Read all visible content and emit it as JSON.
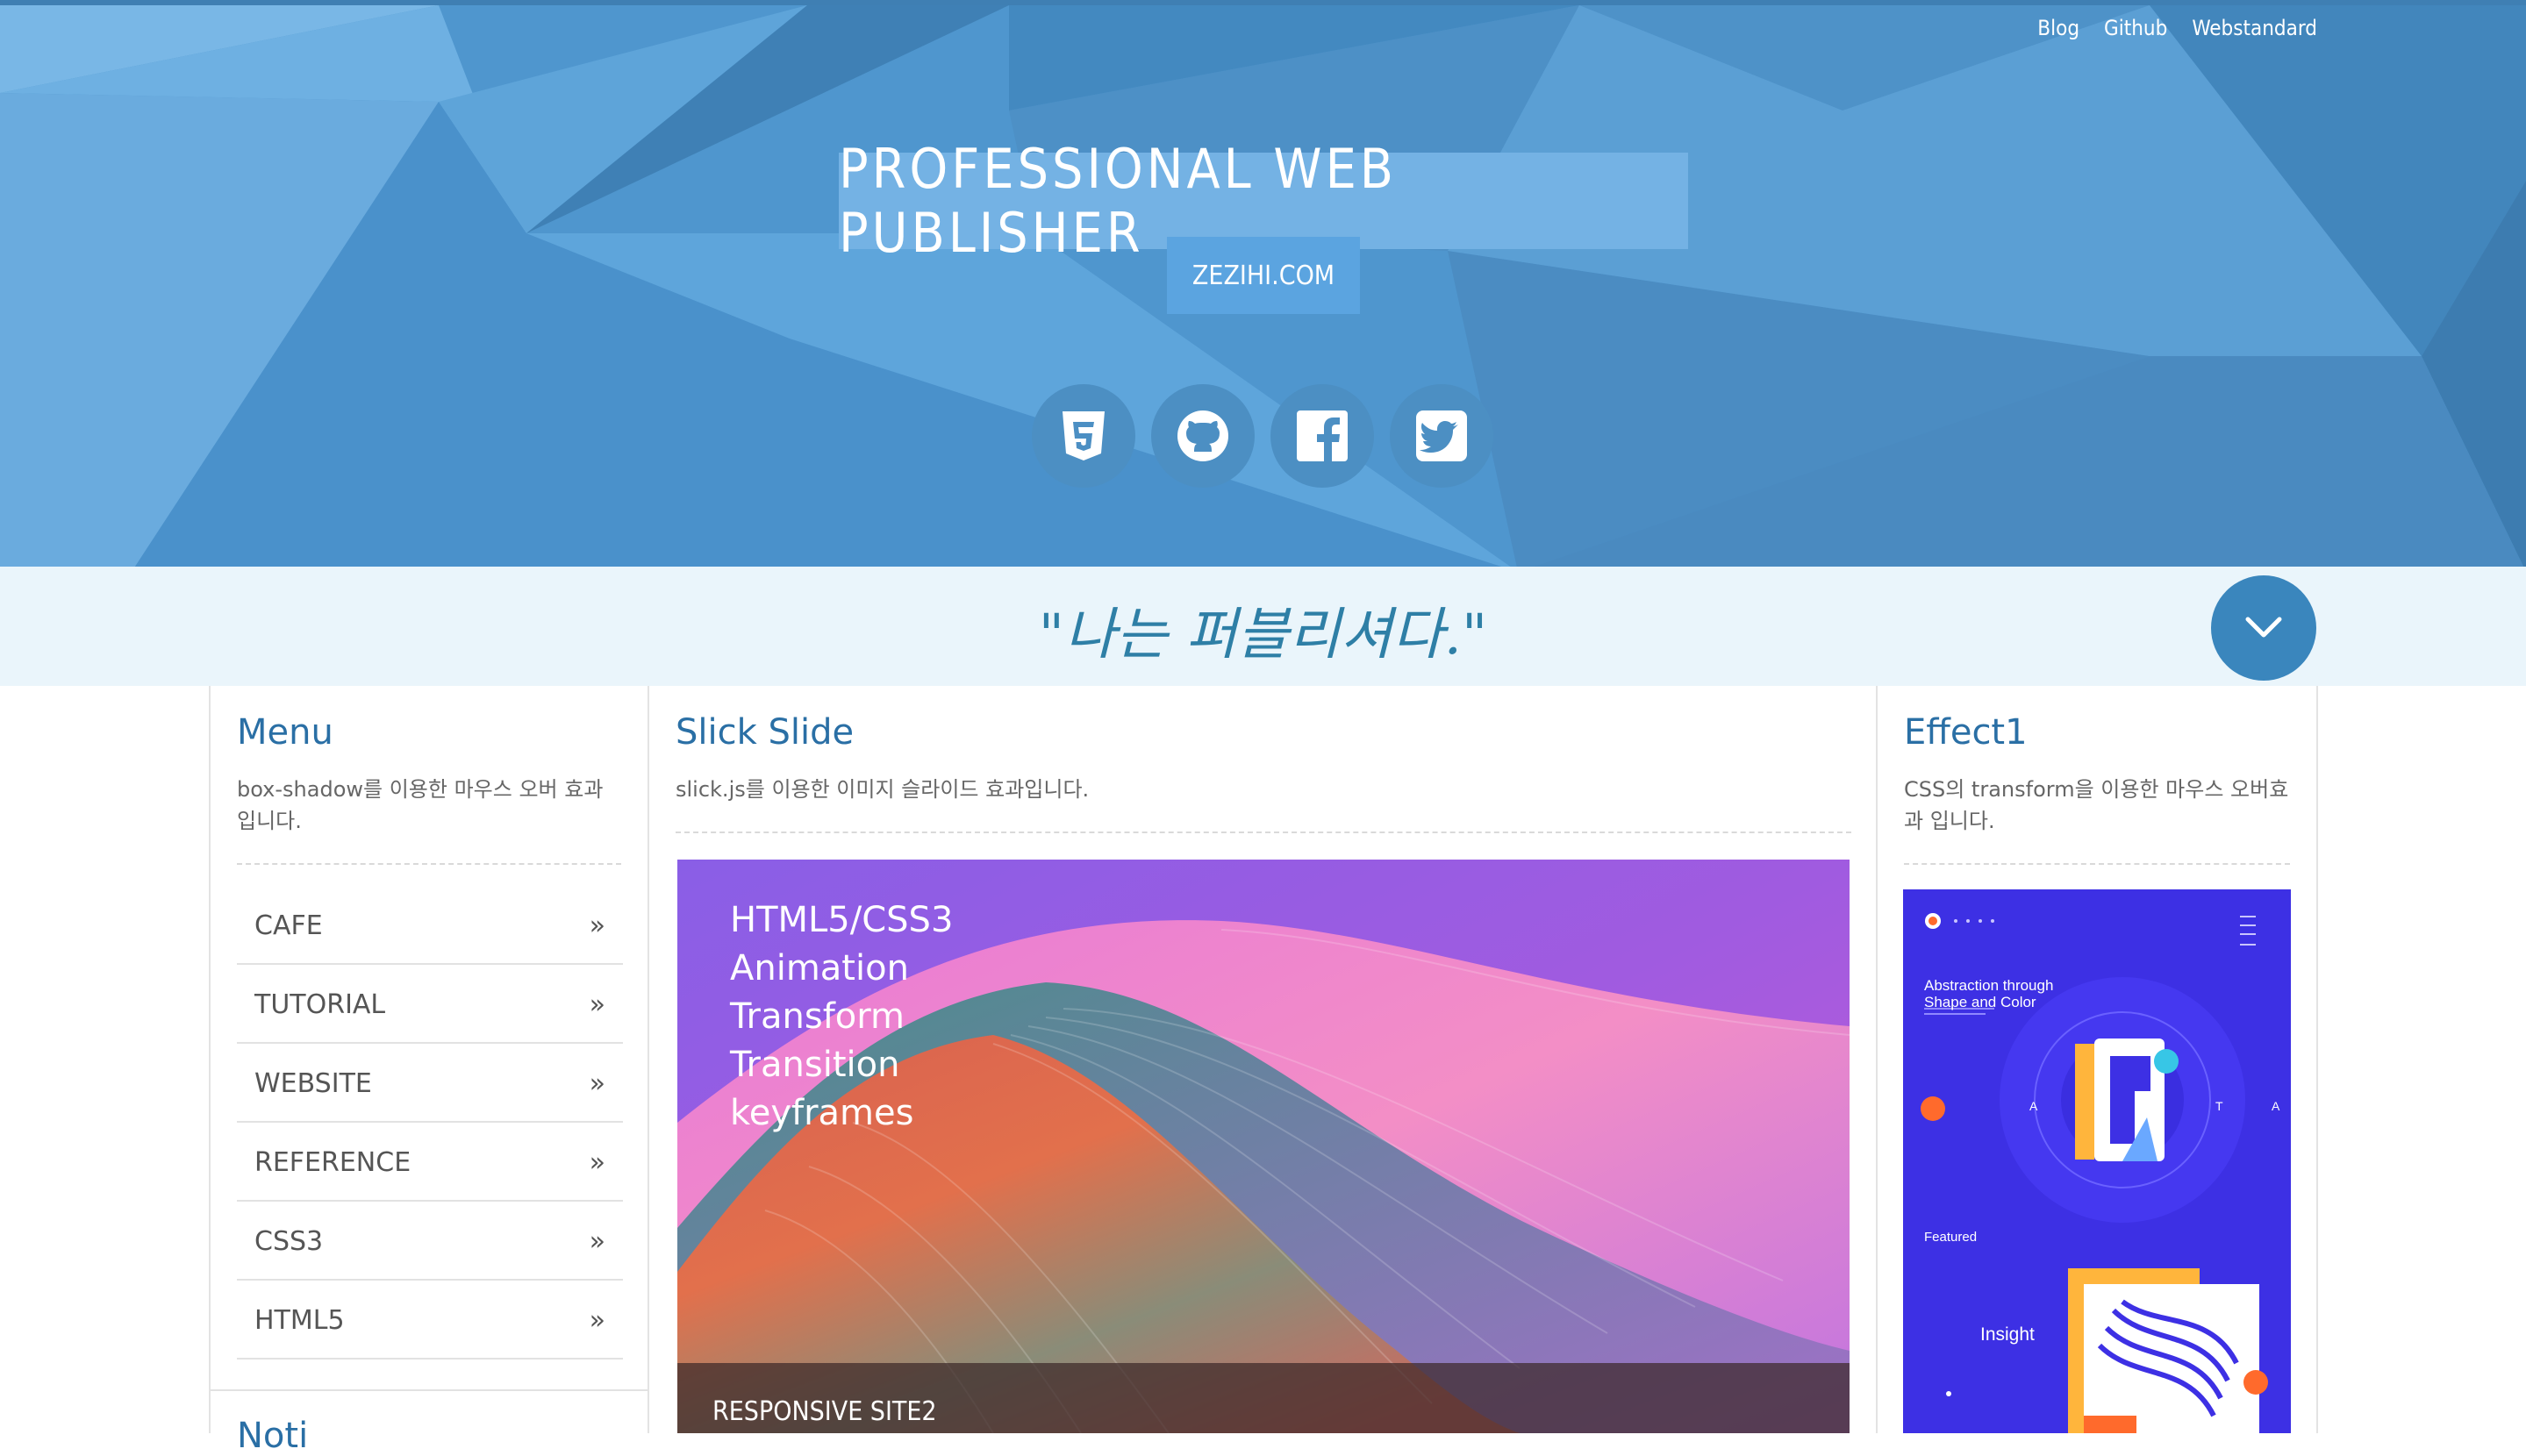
{
  "top_nav": [
    "Blog",
    "Github",
    "Webstandard"
  ],
  "header": {
    "title": "PROFESSIONAL WEB PUBLISHER",
    "domain": "ZEZIHI.COM"
  },
  "social_icons": [
    "html5-icon",
    "github-icon",
    "facebook-icon",
    "twitter-icon"
  ],
  "quote": "\"나는 퍼블리셔다.\"",
  "menu": {
    "title": "Menu",
    "desc": "box-shadow를 이용한 마우스 오버 효과입니다.",
    "items": [
      "CAFE",
      "TUTORIAL",
      "WEBSITE",
      "REFERENCE",
      "CSS3",
      "HTML5"
    ],
    "next_title": "Noti"
  },
  "slider": {
    "title": "Slick Slide",
    "desc": "slick.js를 이용한 이미지 슬라이드 효과입니다.",
    "lines": [
      "HTML5/CSS3",
      "Animation",
      "Transform",
      "Transition",
      "keyframes"
    ],
    "caption": "RESPONSIVE SITE2"
  },
  "effect": {
    "title": "Effect1",
    "desc": "CSS의 transform을 이용한 마우스 오버효과 입니다.",
    "poster_heading": "Abstraction through Shape and Color",
    "poster_featured": "Featured",
    "poster_insight": "Insight",
    "poster_letter": "R"
  },
  "colors": {
    "header_bg": "#4d94cc",
    "accent": "#2a6fa5",
    "quote_bg": "#eaf5fb"
  }
}
